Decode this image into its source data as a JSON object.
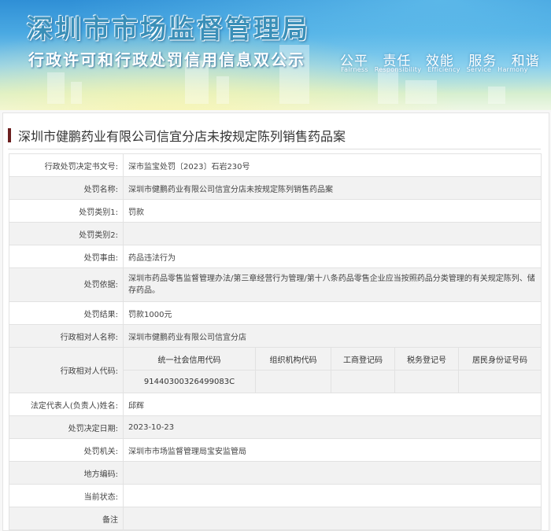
{
  "banner": {
    "title": "深圳市市场监督管理局",
    "subtitle": "行政许可和行政处罚信用信息双公示",
    "slogans_cn": [
      "公平",
      "责任",
      "效能",
      "服务",
      "和谐"
    ],
    "slogans_en": [
      "Fairness",
      "Responsibility",
      "Efficiency",
      "Service",
      "Harmony"
    ]
  },
  "case": {
    "title": "深圳市健鹏药业有限公司信宜分店未按规定陈列销售药品案",
    "accent_color": "#6b1f1f"
  },
  "rows": [
    {
      "label": "行政处罚决定书文号:",
      "value": "深市监宝处罚〔2023〕石岩230号"
    },
    {
      "label": "处罚名称:",
      "value": "深圳市健鹏药业有限公司信宜分店未按规定陈列销售药品案"
    },
    {
      "label": "处罚类别1:",
      "value": "罚款"
    },
    {
      "label": "处罚类别2:",
      "value": ""
    },
    {
      "label": "处罚事由:",
      "value": "药品违法行为"
    },
    {
      "label": "处罚依据:",
      "value": "深圳市药品零售监督管理办法/第三章经营行为管理/第十八条药品零售企业应当按照药品分类管理的有关规定陈列、储存药品。"
    },
    {
      "label": "处罚结果:",
      "value": "罚款1000元"
    },
    {
      "label": "行政相对人名称:",
      "value": "深圳市健鹏药业有限公司信宜分店"
    }
  ],
  "codes": {
    "label": "行政相对人代码:",
    "headers": [
      "统一社会信用代码",
      "组织机构代码",
      "工商登记码",
      "税务登记号",
      "居民身份证号码"
    ],
    "values": [
      "91440300326499083C",
      "",
      "",
      "",
      ""
    ]
  },
  "rows2": [
    {
      "label": "法定代表人(负责人)姓名:",
      "value": "邱辉"
    },
    {
      "label": "处罚决定日期:",
      "value": "2023-10-23"
    },
    {
      "label": "处罚机关:",
      "value": "深圳市市场监督管理局宝安监管局"
    },
    {
      "label": "地方编码:",
      "value": ""
    },
    {
      "label": "当前状态:",
      "value": ""
    },
    {
      "label": "备注",
      "value": ""
    }
  ]
}
